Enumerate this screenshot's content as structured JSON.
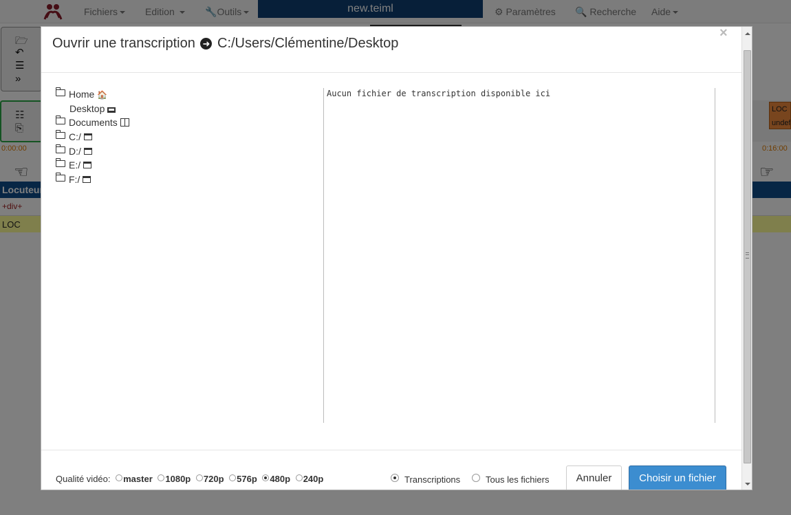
{
  "app": {
    "menu": {
      "fichiers": "Fichiers",
      "edition": "Edition",
      "outils": "Outils",
      "parametres": "Paramètres",
      "recherche": "Recherche",
      "aide": "Aide"
    },
    "file_title": "new.teiml",
    "time_start": "0:00:00",
    "time_end": "0:16:00",
    "column_header": "Locuteur",
    "div_row": "+div+",
    "loc_row": "LOC",
    "loc_tag": "LOC",
    "loc_tag_sub": "undef"
  },
  "modal": {
    "title_prefix": "Ouvrir une transcription",
    "title_path": "C:/Users/Clémentine/Desktop",
    "close": "×",
    "tree": [
      {
        "label": "Home",
        "icon": "home-icon"
      },
      {
        "label": "Desktop",
        "icon": "monitor-icon"
      },
      {
        "label": "Documents",
        "icon": "book-icon"
      },
      {
        "label": "C:/",
        "icon": "drive-icon"
      },
      {
        "label": "D:/",
        "icon": "drive-icon"
      },
      {
        "label": "E:/",
        "icon": "drive-icon"
      },
      {
        "label": "F:/",
        "icon": "drive-icon"
      }
    ],
    "empty_message": "Aucun fichier de transcription disponible ici",
    "quality_label": "Qualité vidéo:",
    "quality_options": [
      "master",
      "1080p",
      "720p",
      "576p",
      "480p",
      "240p"
    ],
    "quality_selected": "480p",
    "filter_transcriptions": "Transcriptions",
    "filter_all": "Tous les fichiers",
    "filter_selected": "Transcriptions",
    "cancel": "Annuler",
    "choose": "Choisir un fichier"
  },
  "colors": {
    "primary_button": "#3c8dd0",
    "title_bar": "#0f3f72",
    "locuteur_header": "#0f4d8a",
    "loc_row": "#ffff99",
    "loc_tag": "#f08a3c",
    "time": "#e07b00"
  }
}
